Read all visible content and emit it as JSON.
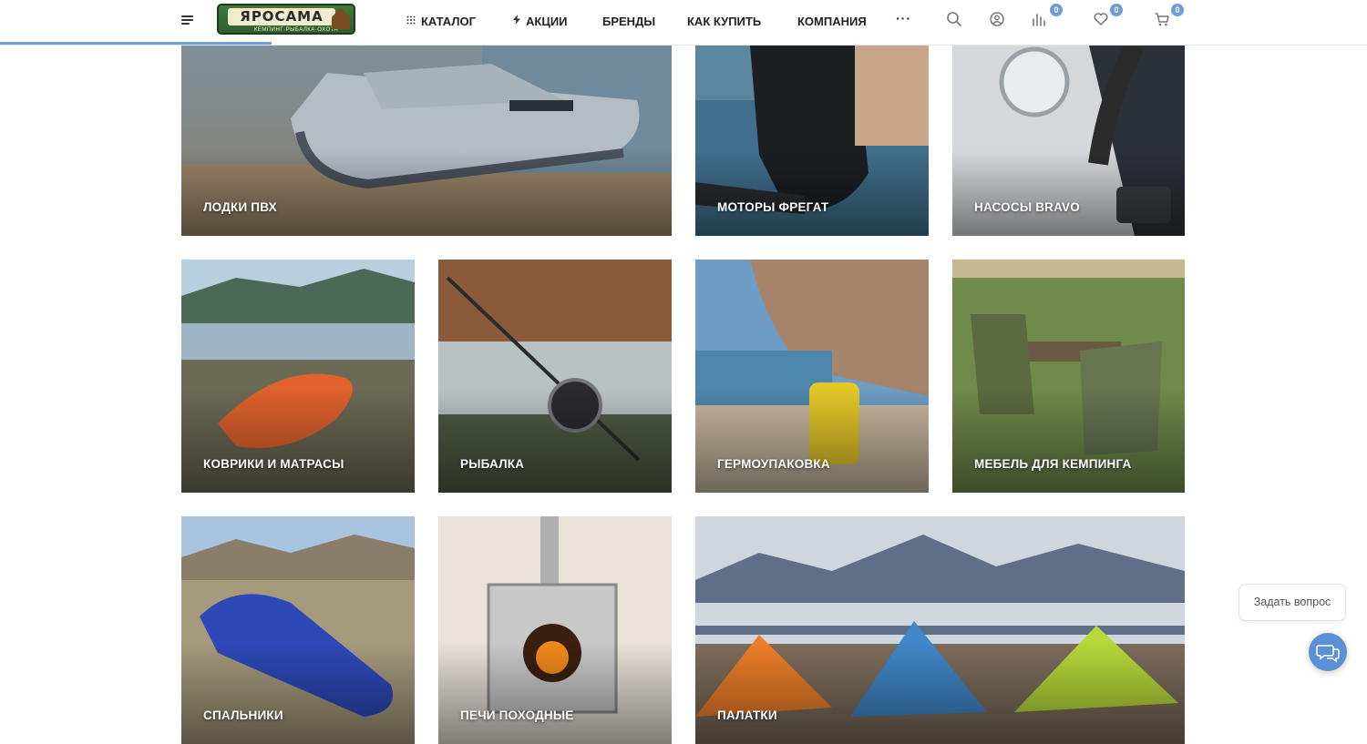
{
  "header": {
    "logo_title": "ЯРОСАМА",
    "logo_subtitle": "КЕМПИНГ·РЫБАЛКА·ОХОТА",
    "nav": {
      "catalog": "КАТАЛОГ",
      "sales": "АКЦИИ",
      "brands": "БРЕНДЫ",
      "how_to_buy": "КАК КУПИТЬ",
      "company": "КОМПАНИЯ",
      "more": "···"
    },
    "compare_count": "0",
    "favorites_count": "0",
    "cart_count": "0",
    "accent_color": "#6f9bd6",
    "icons": [
      "menu-icon",
      "search-icon",
      "user-icon",
      "compare-icon",
      "heart-icon",
      "cart-icon"
    ]
  },
  "categories": [
    {
      "label": "ЛОДКИ ПВХ"
    },
    {
      "label": "МОТОРЫ ФРЕГАТ"
    },
    {
      "label": "НАСОСЫ BRAVO"
    },
    {
      "label": "КОВРИКИ И МАТРАСЫ"
    },
    {
      "label": "РЫБАЛКА"
    },
    {
      "label": "ГЕРМОУПАКОВКА"
    },
    {
      "label": "МЕБЕЛЬ ДЛЯ КЕМПИНГА"
    },
    {
      "label": "СПАЛЬНИКИ"
    },
    {
      "label": "ПЕЧИ ПОХОДНЫЕ"
    },
    {
      "label": "ПАЛАТКИ"
    }
  ],
  "chat": {
    "ask_label": "Задать вопрос",
    "button_color": "#5b8fd6"
  }
}
